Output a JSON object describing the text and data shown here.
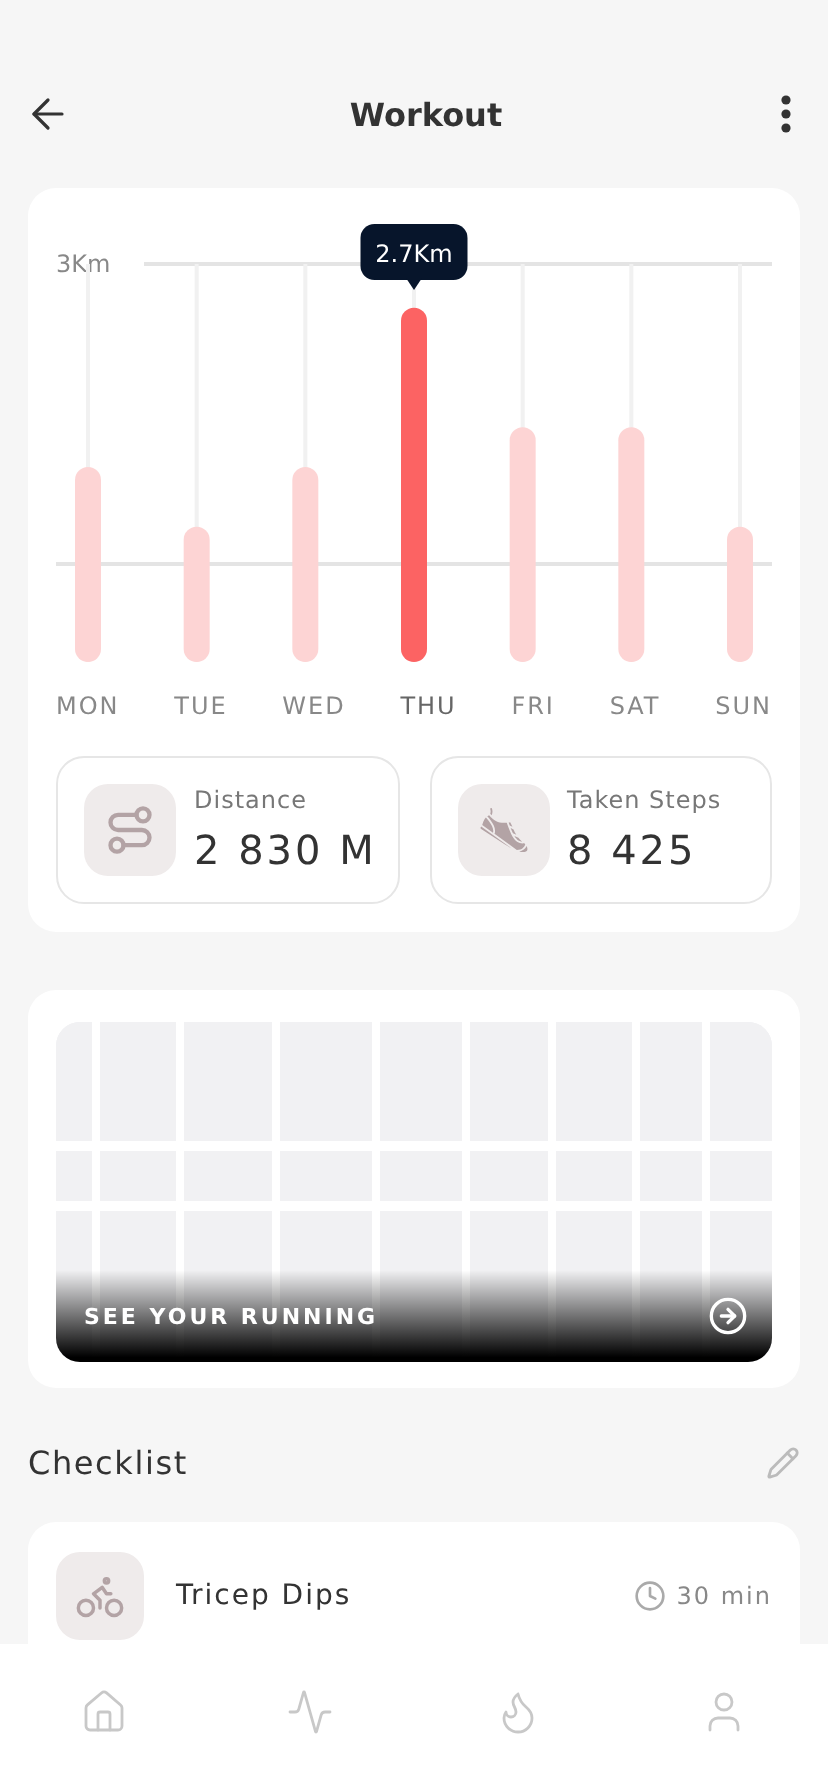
{
  "header": {
    "title": "Workout"
  },
  "activity": {
    "axis_label": "3Km",
    "tooltip": "2.7Km",
    "days": [
      {
        "label": "MON",
        "level": 0.49,
        "selected": false
      },
      {
        "label": "TUE",
        "level": 0.34,
        "selected": false
      },
      {
        "label": "WED",
        "level": 0.49,
        "selected": false
      },
      {
        "label": "THU",
        "level": 0.89,
        "selected": true
      },
      {
        "label": "FRI",
        "level": 0.59,
        "selected": false
      },
      {
        "label": "SAT",
        "level": 0.59,
        "selected": false
      },
      {
        "label": "SUN",
        "level": 0.34,
        "selected": false
      }
    ]
  },
  "stats": [
    {
      "kind": "distance",
      "label": "Distance",
      "value": "2 830 M"
    },
    {
      "kind": "steps",
      "label": "Taken Steps",
      "value": "8 425"
    }
  ],
  "map_card": {
    "caption": "SEE YOUR RUNNING"
  },
  "checklist": {
    "title": "Checklist",
    "items": [
      {
        "kind": "bike",
        "name": "Tricep Dips",
        "duration": "30 min"
      }
    ]
  }
}
